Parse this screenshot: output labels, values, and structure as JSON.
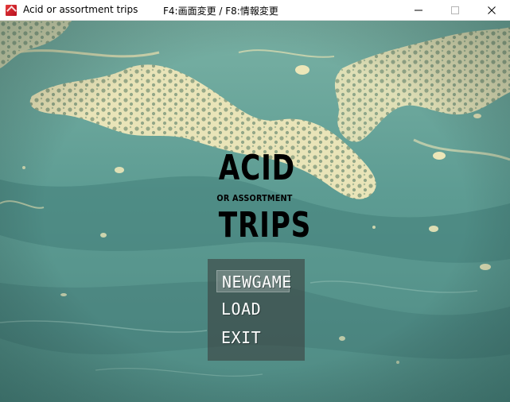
{
  "window": {
    "title": "Acid or assortment trips",
    "hint": "F4:画面変更 / F8:情報変更",
    "icon": "app-icon"
  },
  "logo": {
    "line1": "ACID",
    "line2": "OR ASSORTMENT",
    "line3": "TRIPS"
  },
  "menu": {
    "items": [
      {
        "label": "NEWGAME",
        "selected": true
      },
      {
        "label": "LOAD",
        "selected": false
      },
      {
        "label": "EXIT",
        "selected": false
      }
    ]
  },
  "colors": {
    "background_teal": "#5b9a90",
    "background_cream": "#e6e3b6",
    "menu_panel": "#3c4240",
    "logo_text": "#000000"
  }
}
